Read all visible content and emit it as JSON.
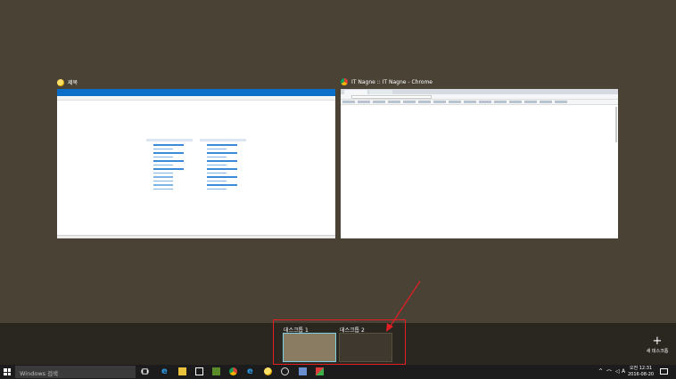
{
  "windows": {
    "left": {
      "title": "제목",
      "icon": "ie-icon"
    },
    "right": {
      "title": "IT Nagne :: IT Nagne - Chrome",
      "icon": "chrome-icon"
    }
  },
  "desktops": {
    "items": [
      {
        "label": "데스크톱 1"
      },
      {
        "label": "데스크톱 2"
      }
    ],
    "new_desktop_label": "새 데스크톱",
    "new_desktop_icon": "plus-icon"
  },
  "taskbar": {
    "search_placeholder": "Windows 검색",
    "ime_label": "A",
    "clock": {
      "time": "오전 12:31",
      "date": "2016-08-20"
    }
  },
  "colors": {
    "background": "#4a4235",
    "strip": "#2a2620",
    "highlight": "#e31e24",
    "taskbar": "#1c1c1c"
  }
}
